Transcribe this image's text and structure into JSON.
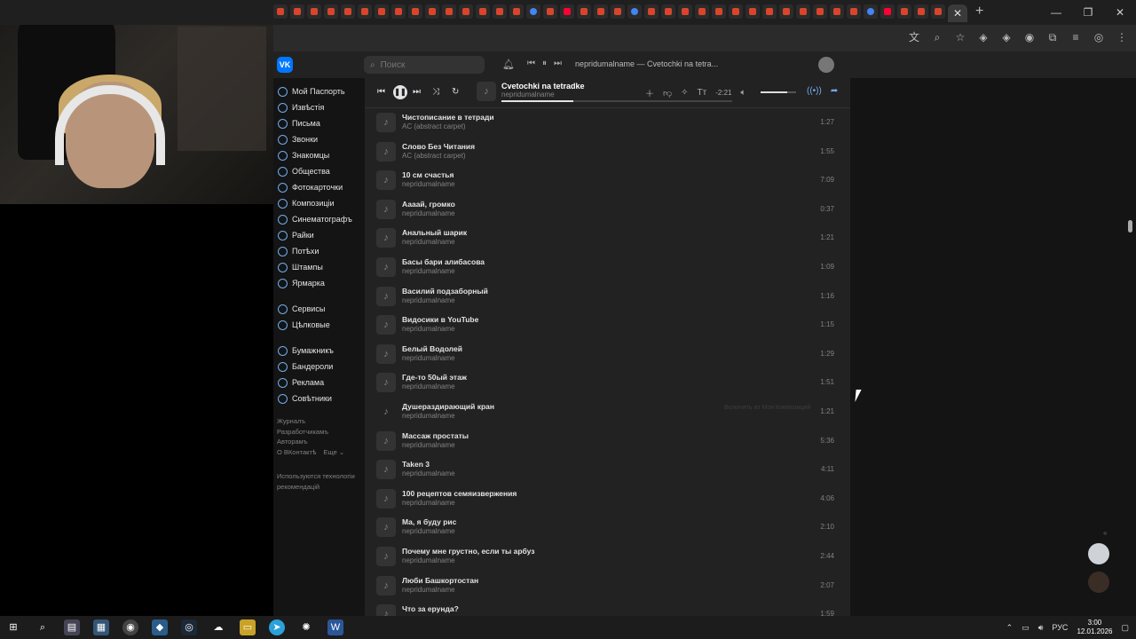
{
  "browser": {
    "tab_count_label": "",
    "close_tab_glyph": "✕",
    "new_tab_glyph": "+",
    "window_controls": [
      "—",
      "❐",
      "✕"
    ],
    "tool_icons": [
      "translate-icon",
      "zoom-icon",
      "star-icon",
      "extension-15-icon",
      "extension-11-icon",
      "extension-icon",
      "puzzle-icon",
      "media-icon",
      "profile-icon",
      "menu-icon"
    ],
    "tool_glyphs": [
      "文",
      "⌕",
      "☆",
      "◈",
      "◈",
      "◉",
      "⧉",
      "≡",
      "◎",
      "⋮"
    ]
  },
  "vk": {
    "logo": "VK",
    "search_placeholder": "Поиск",
    "mini_player_track": "nepridumalname — Cvetochki na tetra...",
    "sidebar": [
      {
        "label": "Мой Паспорть"
      },
      {
        "label": "Извѣстія"
      },
      {
        "label": "Письма"
      },
      {
        "label": "Звонки"
      },
      {
        "label": "Знакомцы"
      },
      {
        "label": "Общества"
      },
      {
        "label": "Фотокарточки"
      },
      {
        "label": "Композиціи"
      },
      {
        "label": "Синематографъ"
      },
      {
        "label": "Райки"
      },
      {
        "label": "Потѣхи"
      },
      {
        "label": "Штампы"
      },
      {
        "label": "Ярмарка"
      }
    ],
    "sidebar_group2": [
      {
        "label": "Сервисы"
      },
      {
        "label": "Цѣлковые"
      }
    ],
    "sidebar_group3": [
      {
        "label": "Бумажникъ"
      },
      {
        "label": "Бандероли"
      },
      {
        "label": "Реклама"
      },
      {
        "label": "Совѣтники"
      }
    ],
    "footer": {
      "links": [
        "Журналъ",
        "Разработчикамъ",
        "Авторамъ"
      ],
      "about": "О ВКонтактѣ",
      "more": "Еще ⌄",
      "tech_note": "Используются технологіи рекомендацій"
    },
    "player": {
      "title": "Cvetochki na tetradke",
      "artist": "nepridumalname",
      "time": "-2:21",
      "progress": 0.31,
      "volume": 0.75
    },
    "hint_text": "Включить из Моя Композиций",
    "tracks": [
      {
        "title": "Чистописание в тетради",
        "artist": "AC (abstract carpet)",
        "duration": "1:27"
      },
      {
        "title": "Слово Без Читания",
        "artist": "AC (abstract carpet)",
        "duration": "1:55"
      },
      {
        "title": "10 см счастья",
        "artist": "nepridumalname",
        "duration": "7:09"
      },
      {
        "title": "Аааай, громко",
        "artist": "nepridumalname",
        "duration": "0:37"
      },
      {
        "title": "Анальный шарик",
        "artist": "nepridumalname",
        "duration": "1:21"
      },
      {
        "title": "Басы бари алибасова",
        "artist": "nepridumalname",
        "duration": "1:09"
      },
      {
        "title": "Василий подзаборный",
        "artist": "nepridumalname",
        "duration": "1:16"
      },
      {
        "title": "Видосики в YouTube",
        "artist": "nepridumalname",
        "duration": "1:15"
      },
      {
        "title": "Белый Водолей",
        "artist": "nepridumalname",
        "duration": "1:29"
      },
      {
        "title": "Где-то 50ый этаж",
        "artist": "nepridumalname",
        "duration": "1:51"
      },
      {
        "title": "Душераздирающий кран",
        "artist": "nepridumalname",
        "duration": "1:21"
      },
      {
        "title": "Массаж простаты",
        "artist": "nepridumalname",
        "duration": "5:36"
      },
      {
        "title": "Taken 3",
        "artist": "nepridumalname",
        "duration": "4:11"
      },
      {
        "title": "100 рецептов семяизвержения",
        "artist": "nepridumalname",
        "duration": "4:06"
      },
      {
        "title": "Ма, я буду рис",
        "artist": "nepridumalname",
        "duration": "2:10"
      },
      {
        "title": "Почему мне грустно, если ты арбуз",
        "artist": "nepridumalname",
        "duration": "2:44"
      },
      {
        "title": "Люби Башкортостан",
        "artist": "nepridumalname",
        "duration": "2:07"
      },
      {
        "title": "Что за ерунда?",
        "artist": "",
        "duration": "1:59"
      }
    ]
  },
  "taskbar": {
    "language": "РУС",
    "time": "3:00",
    "date": "12.01.2026"
  },
  "colors": {
    "vk_blue": "#0077ff",
    "link_blue": "#71aaeb",
    "bg_dark": "#141414",
    "panel": "#222222"
  }
}
